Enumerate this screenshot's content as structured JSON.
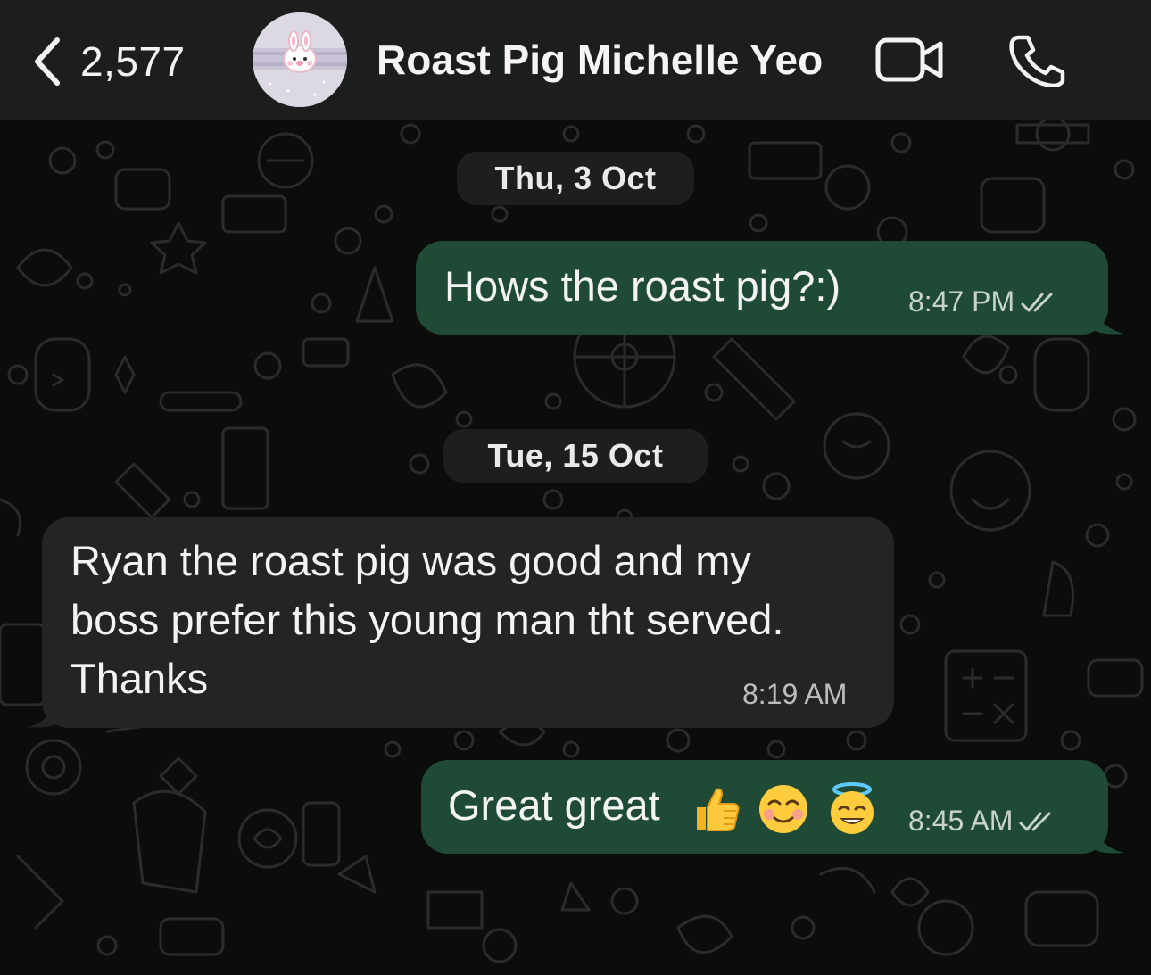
{
  "header": {
    "back_count": "2,577",
    "contact_name": "Roast Pig Michelle Yeo"
  },
  "icons": {
    "back": "chevron-left-icon",
    "video": "video-camera-icon",
    "call": "phone-icon",
    "read_receipt": "double-check-icon"
  },
  "colors": {
    "header_bg": "#1c1d1d",
    "chat_bg": "#0c0c0c",
    "outgoing_bubble": "#1f4a35",
    "incoming_bubble": "#232424",
    "read_tick": "#c8d2cc"
  },
  "conversation": {
    "date_1": "Thu, 3 Oct",
    "date_2": "Tue, 15 Oct",
    "msg_1": {
      "text": "Hows the roast pig?:)",
      "time": "8:47 PM",
      "direction": "outgoing"
    },
    "msg_2": {
      "line_1": "Ryan the roast pig was good and my",
      "line_2": "boss prefer this young man tht served.",
      "line_3": "Thanks",
      "time": "8:19 AM",
      "direction": "incoming"
    },
    "msg_3": {
      "text": "Great great",
      "emojis": [
        "thumbs-up-emoji",
        "smiling-blush-emoji",
        "halo-smile-emoji"
      ],
      "time": "8:45 AM",
      "direction": "outgoing"
    }
  }
}
